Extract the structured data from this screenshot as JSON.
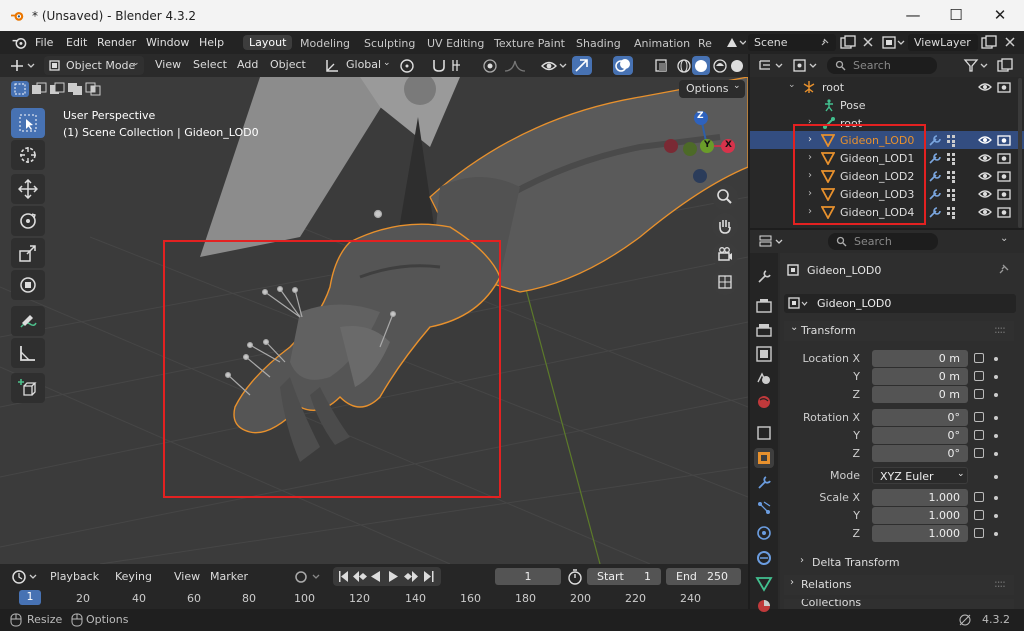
{
  "window": {
    "title": "* (Unsaved) - Blender 4.3.2",
    "minimize": "—",
    "maximize": "☐",
    "close": "✕"
  },
  "menu": {
    "items": [
      "File",
      "Edit",
      "Render",
      "Window",
      "Help"
    ],
    "workspaces": [
      "Layout",
      "Modeling",
      "Sculpting",
      "UV Editing",
      "Texture Paint",
      "Shading",
      "Animation",
      "Re"
    ],
    "active_workspace": "Layout",
    "scene": "Scene",
    "view_layer": "ViewLayer"
  },
  "viewport_header": {
    "mode": "Object Mode",
    "menus": [
      "View",
      "Select",
      "Add",
      "Object"
    ],
    "transform_orientation": "Global"
  },
  "viewport": {
    "perspective": "User Perspective",
    "collection_info": "(1) Scene Collection | Gideon_LOD0",
    "options_label": "Options",
    "gizmo": {
      "z": "Z",
      "y": "Y",
      "x": "X"
    }
  },
  "outliner": {
    "search_placeholder": "Search",
    "rows": [
      {
        "label": "root",
        "icon": "armature-icon"
      },
      {
        "label": "Pose",
        "icon": "pose-icon"
      },
      {
        "label": "root",
        "icon": "bone-icon"
      },
      {
        "label": "Gideon_LOD0",
        "icon": "mesh-icon",
        "selected": true
      },
      {
        "label": "Gideon_LOD1",
        "icon": "mesh-icon"
      },
      {
        "label": "Gideon_LOD2",
        "icon": "mesh-icon"
      },
      {
        "label": "Gideon_LOD3",
        "icon": "mesh-icon"
      },
      {
        "label": "Gideon_LOD4",
        "icon": "mesh-icon"
      }
    ]
  },
  "properties": {
    "search_placeholder": "Search",
    "object_name": "Gideon_LOD0",
    "datablock_name": "Gideon_LOD0",
    "transform": {
      "title": "Transform",
      "location_label": "Location X",
      "location": [
        "0 m",
        "0 m",
        "0 m"
      ],
      "rotation_label": "Rotation X",
      "rotation": [
        "0°",
        "0°",
        "0°"
      ],
      "mode_label": "Mode",
      "mode": "XYZ Euler",
      "scale_label": "Scale X",
      "scale": [
        "1.000",
        "1.000",
        "1.000"
      ],
      "y_label": "Y",
      "z_label": "Z"
    },
    "delta_transform": "Delta Transform",
    "relations": "Relations",
    "collections": "Collections"
  },
  "timeline": {
    "menus": [
      "Playback",
      "Keying",
      "View",
      "Marker"
    ],
    "current_frame": "1",
    "start_label": "Start",
    "start": "1",
    "end_label": "End",
    "end": "250",
    "ruler": [
      "1",
      "20",
      "40",
      "60",
      "80",
      "100",
      "120",
      "140",
      "160",
      "180",
      "200",
      "220",
      "240"
    ]
  },
  "status": {
    "left1": "Resize",
    "left2": "Options",
    "version": "4.3.2"
  },
  "colors": {
    "accent": "#4772b3",
    "selection_outline": "#e8912d",
    "annotation_red": "#e32121",
    "mesh_icon": "#e8912d"
  }
}
